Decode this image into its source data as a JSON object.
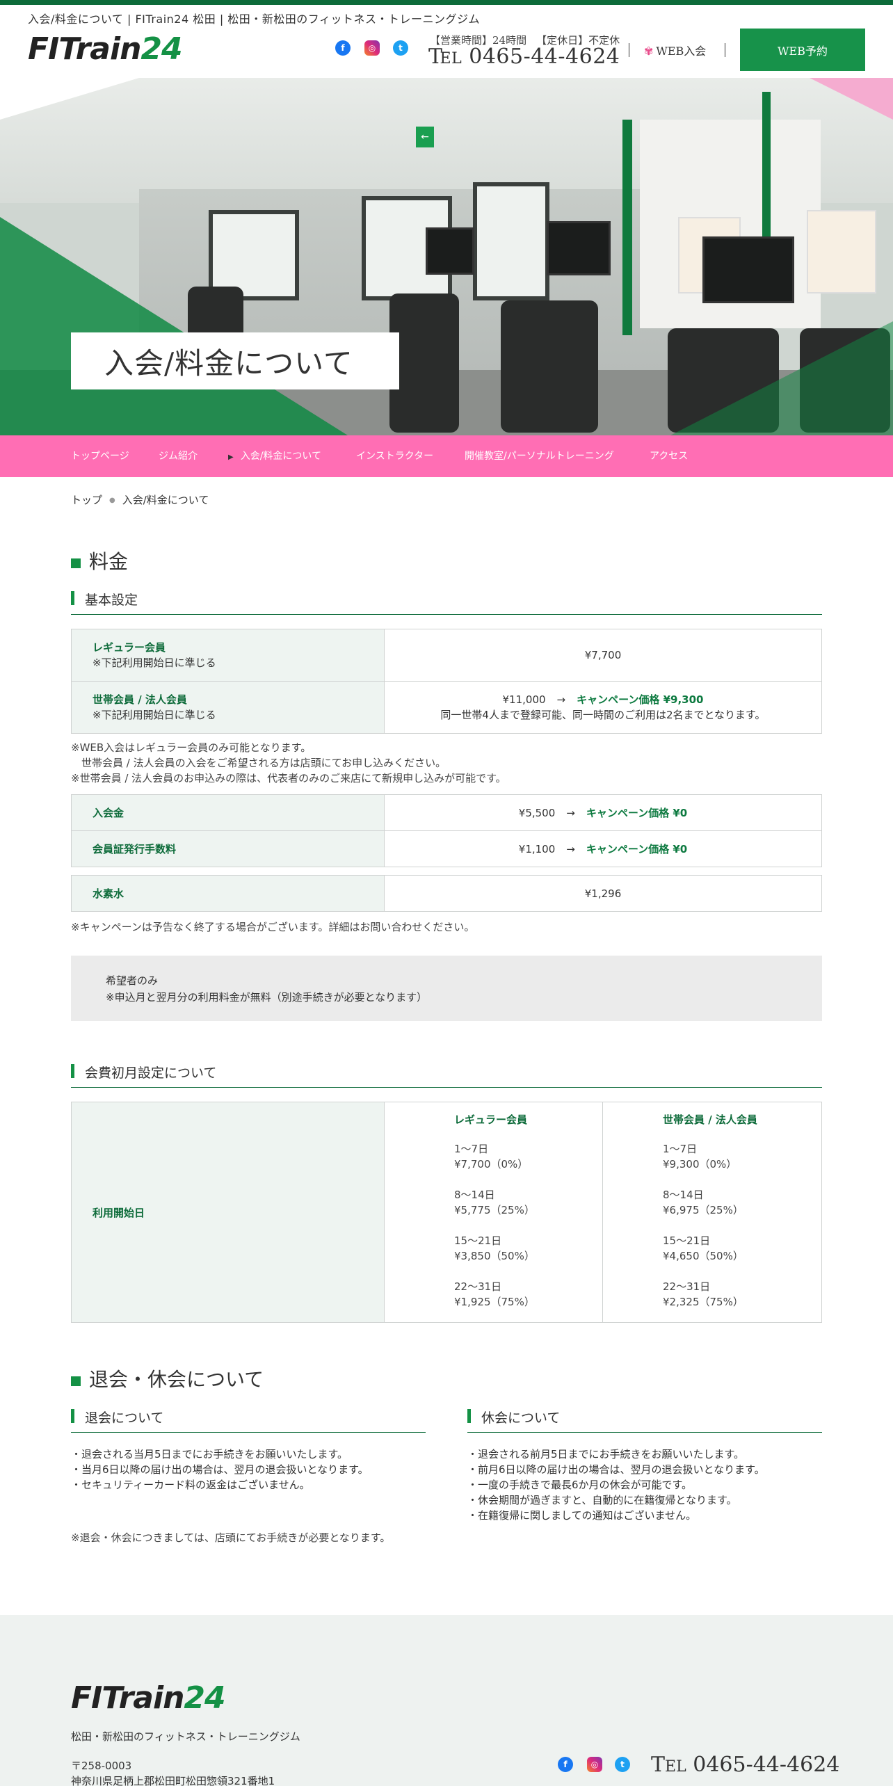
{
  "header": {
    "tagline": "入会/料金について | FITrain24 松田 | 松田・新松田のフィットネス・トレーニングジム",
    "logo_part1": "FITrain",
    "logo_part2": "24",
    "social": {
      "facebook": "f",
      "instagram": "◎",
      "twitter": "t"
    },
    "hours_label": "【営業時間】24時間",
    "closed_label": "【定休日】不定休",
    "tel_prefix_t": "T",
    "tel_prefix_el": "EL",
    "tel_number": "0465-44-4624",
    "web_join": "WEB入会",
    "reserve_button": "WEB予約"
  },
  "hero": {
    "title": "入会/料金について"
  },
  "nav": {
    "items": [
      {
        "label": "トップページ"
      },
      {
        "label": "ジム紹介"
      },
      {
        "label": "入会/料金について",
        "active": true
      },
      {
        "label": "インストラクター"
      },
      {
        "label": "開催教室/パーソナルトレーニング"
      },
      {
        "label": "アクセス"
      }
    ]
  },
  "breadcrumb": {
    "home": "トップ",
    "current": "入会/料金について"
  },
  "pricing": {
    "heading": "料金",
    "basic_heading": "基本設定",
    "rows1": [
      {
        "label": "レギュラー会員",
        "sub": "※下記利用開始日に準じる",
        "value": "¥7,700"
      },
      {
        "label": "世帯会員 / 法人会員",
        "sub": "※下記利用開始日に準じる",
        "value_main": "¥11,000",
        "arrow": "→",
        "campaign": "キャンペーン価格 ¥9,300",
        "value_note": "同一世帯4人まで登録可能、同一時間のご利用は2名までとなります。"
      }
    ],
    "notes1": [
      "※WEB入会はレギュラー会員のみ可能となります。",
      "　世帯会員 / 法人会員の入会をご希望される方は店頭にてお申し込みください。",
      "※世帯会員 / 法人会員のお申込みの際は、代表者のみのご来店にて新規申し込みが可能です。"
    ],
    "rows2": [
      {
        "label": "入会金",
        "value": "¥5,500",
        "arrow": "→",
        "campaign": "キャンペーン価格 ¥0"
      },
      {
        "label": "会員証発行手数料",
        "value": "¥1,100",
        "arrow": "→",
        "campaign": "キャンペーン価格 ¥0"
      }
    ],
    "rows3": [
      {
        "label": "水素水",
        "value": "¥1,296"
      }
    ],
    "campaign_note": "※キャンペーンは予告なく終了する場合がございます。詳細はお問い合わせください。",
    "infobox_line1": "希望者のみ",
    "infobox_line2": "※申込月と翌月分の利用料金が無料（別途手続きが必要となります）"
  },
  "monthly": {
    "heading": "会費初月設定について",
    "row_label": "利用開始日",
    "columns": [
      {
        "title": "レギュラー会員",
        "tiers": [
          {
            "range": "1〜7日",
            "price": "¥7,700（0%）"
          },
          {
            "range": "8〜14日",
            "price": "¥5,775（25%）"
          },
          {
            "range": "15〜21日",
            "price": "¥3,850（50%）"
          },
          {
            "range": "22〜31日",
            "price": "¥1,925（75%）"
          }
        ]
      },
      {
        "title": "世帯会員 / 法人会員",
        "tiers": [
          {
            "range": "1〜7日",
            "price": "¥9,300（0%）"
          },
          {
            "range": "8〜14日",
            "price": "¥6,975（25%）"
          },
          {
            "range": "15〜21日",
            "price": "¥4,650（50%）"
          },
          {
            "range": "22〜31日",
            "price": "¥2,325（75%）"
          }
        ]
      }
    ]
  },
  "withdrawal": {
    "heading": "退会・休会について",
    "left_heading": "退会について",
    "left_items": [
      "・退会される当月5日までにお手続きをお願いいたします。",
      "・当月6日以降の届け出の場合は、翌月の退会扱いとなります。",
      "・セキュリティーカード料の返金はございません。"
    ],
    "right_heading": "休会について",
    "right_items": [
      "・退会される前月5日までにお手続きをお願いいたします。",
      "・前月6日以降の届け出の場合は、翌月の退会扱いとなります。",
      "・一度の手続きで最長6か月の休会が可能です。",
      "・休会期間が過ぎますと、自動的に在籍復帰となります。",
      "・在籍復帰に関しましての通知はございません。"
    ],
    "footnote": "※退会・休会につきましては、店頭にてお手続きが必要となります。"
  },
  "footer": {
    "logo_part1": "FITrain",
    "logo_part2": "24",
    "description": "松田・新松田のフィットネス・トレーニングジム",
    "zip": "〒258-0003",
    "address": "神奈川県足柄上郡松田町松田惣領321番地1",
    "tel_prefix_t": "T",
    "tel_prefix_el": "EL",
    "tel_number": "0465-44-4624"
  },
  "colors": {
    "brand_green": "#149145",
    "dark_green": "#0d6b3a",
    "nav_pink": "#ff6eb4",
    "footer_bg": "#eef2f0"
  },
  "icons": [
    "facebook-icon",
    "instagram-icon",
    "twitter-icon",
    "flower-icon",
    "exit-sign-icon"
  ]
}
